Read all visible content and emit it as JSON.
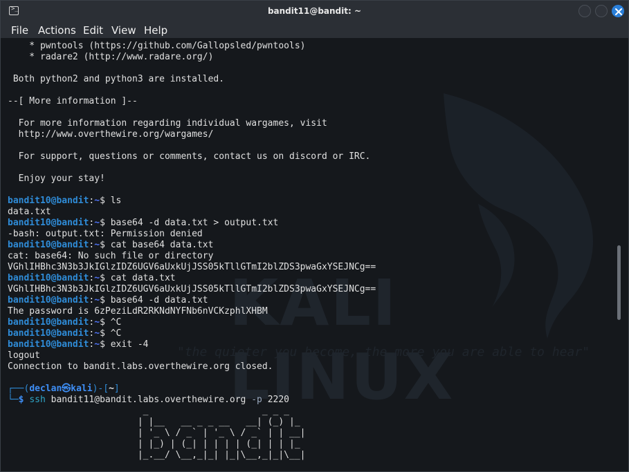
{
  "window": {
    "title": "bandit11@bandit: ~"
  },
  "menu": [
    "File",
    "Actions",
    "Edit",
    "View",
    "Help"
  ],
  "watermark": {
    "text": "KALI LINUX",
    "quote": "\"the quieter you become, the more you are able to hear\""
  },
  "motd": [
    "    * pwntools (https://github.com/Gallopsled/pwntools)",
    "    * radare2 (http://www.radare.org/)",
    "",
    " Both python2 and python3 are installed.",
    "",
    "--[ More information ]--",
    "",
    "  For more information regarding individual wargames, visit",
    "  http://www.overthewire.org/wargames/",
    "",
    "  For support, questions or comments, contact us on discord or IRC.",
    "",
    "  Enjoy your stay!",
    ""
  ],
  "session": [
    {
      "kind": "prompt",
      "user": "bandit10@bandit",
      "path": "~",
      "cmd": "ls"
    },
    {
      "kind": "out",
      "text": "data.txt"
    },
    {
      "kind": "prompt",
      "user": "bandit10@bandit",
      "path": "~",
      "cmd": "base64 -d data.txt > output.txt"
    },
    {
      "kind": "out",
      "text": "-bash: output.txt: Permission denied"
    },
    {
      "kind": "prompt",
      "user": "bandit10@bandit",
      "path": "~",
      "cmd": "cat base64 data.txt"
    },
    {
      "kind": "out",
      "text": "cat: base64: No such file or directory"
    },
    {
      "kind": "out",
      "text": "VGhlIHBhc3N3b3JkIGlzIDZ6UGV6aUxkUjJSS05kTllGTmI2blZDS3pwaGxYSEJNCg=="
    },
    {
      "kind": "prompt",
      "user": "bandit10@bandit",
      "path": "~",
      "cmd": "cat data.txt"
    },
    {
      "kind": "out",
      "text": "VGhlIHBhc3N3b3JkIGlzIDZ6UGV6aUxkUjJSS05kTllGTmI2blZDS3pwaGxYSEJNCg=="
    },
    {
      "kind": "prompt",
      "user": "bandit10@bandit",
      "path": "~",
      "cmd": "base64 -d data.txt"
    },
    {
      "kind": "out",
      "text": "The password is 6zPeziLdR2RKNdNYFNb6nVCKzphlXHBM"
    },
    {
      "kind": "prompt",
      "user": "bandit10@bandit",
      "path": "~",
      "cmd": "^C"
    },
    {
      "kind": "prompt",
      "user": "bandit10@bandit",
      "path": "~",
      "cmd": "^C"
    },
    {
      "kind": "prompt",
      "user": "bandit10@bandit",
      "path": "~",
      "cmd": "exit -4"
    },
    {
      "kind": "out",
      "text": "logout"
    },
    {
      "kind": "out",
      "text": "Connection to bandit.labs.overthewire.org closed."
    },
    {
      "kind": "out",
      "text": ""
    }
  ],
  "kali_prompt": {
    "top_frame_left": "┌──(",
    "user": "declan㉿kali",
    "mid": ")-[",
    "dir": "~",
    "close": "]",
    "bottom_frame": "└─",
    "dollar": "$",
    "cmd": "ssh",
    "args": " bandit11@bandit.labs.overthewire.org ",
    "flag": "-p",
    "port": " 2220"
  },
  "ascii_banner": [
    "                         _                     _ _ _   ",
    "                        | |__   __ _ _ __   __| (_) |_ ",
    "                        | '_ \\ / _` | '_ \\ / _` | | __|",
    "                        | |_) | (_| | | | | (_| | | |_ ",
    "                        |_.__/ \\__,_|_| |_|\\__,_|_|\\__|"
  ]
}
